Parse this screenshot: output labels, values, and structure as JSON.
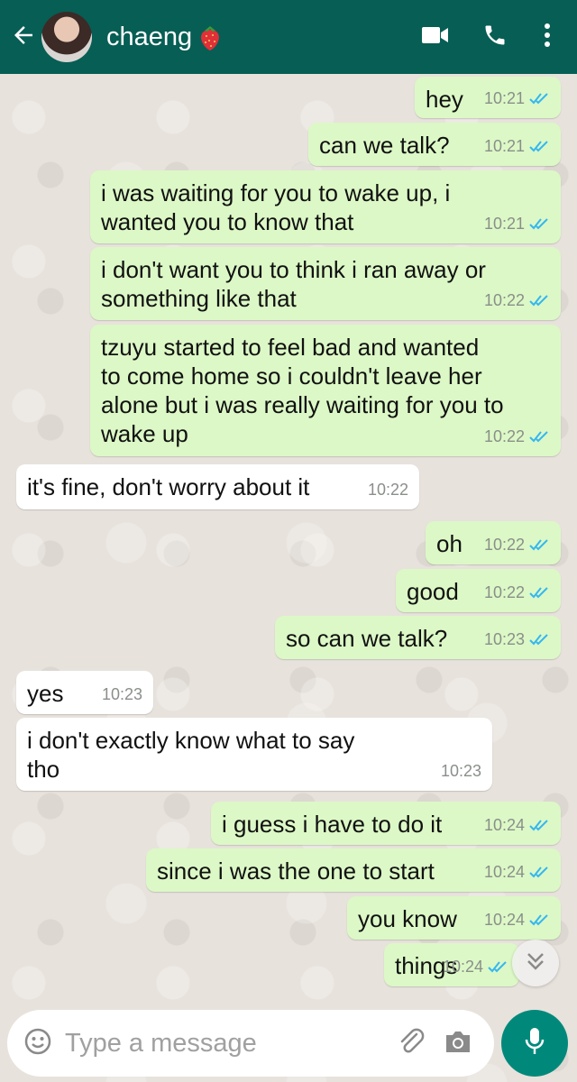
{
  "header": {
    "back_icon": "arrow-left-icon",
    "contact_name": "chaeng",
    "contact_emoji": "strawberry",
    "actions": [
      "video-call-icon",
      "voice-call-icon",
      "more-vert-icon"
    ]
  },
  "messages": [
    {
      "dir": "out",
      "text": "hey",
      "time": "10:21",
      "read": true
    },
    {
      "dir": "out",
      "text": "can we talk?",
      "time": "10:21",
      "read": true
    },
    {
      "dir": "out",
      "text": "i was waiting for you to wake up, i\nwanted you to know that",
      "time": "10:21",
      "read": true
    },
    {
      "dir": "out",
      "text": "i don't want you to think i ran away or\nsomething like that",
      "time": "10:22",
      "read": true
    },
    {
      "dir": "out",
      "text": "tzuyu started to feel bad and wanted\nto come home so i couldn't leave her\nalone but i was really waiting for you to\nwake up",
      "time": "10:22",
      "read": true
    },
    {
      "dir": "in",
      "text": "it's fine, don't worry about it",
      "time": "10:22"
    },
    {
      "dir": "out",
      "text": "oh",
      "time": "10:22",
      "read": true
    },
    {
      "dir": "out",
      "text": "good",
      "time": "10:22",
      "read": true
    },
    {
      "dir": "out",
      "text": "so can we talk?",
      "time": "10:23",
      "read": true
    },
    {
      "dir": "in",
      "text": "yes",
      "time": "10:23"
    },
    {
      "dir": "in",
      "text": "i don't exactly know what to say\ntho",
      "time": "10:23"
    },
    {
      "dir": "out",
      "text": "i guess i have to do it",
      "time": "10:24",
      "read": true
    },
    {
      "dir": "out",
      "text": "since i was the one to start",
      "time": "10:24",
      "read": true
    },
    {
      "dir": "out",
      "text": "you know",
      "time": "10:24",
      "read": true
    },
    {
      "dir": "out",
      "text": "things",
      "time": "10:24",
      "read": true
    }
  ],
  "composer": {
    "placeholder": "Type a message",
    "emoji_icon": "smiley-icon",
    "attach_icon": "paperclip-icon",
    "camera_icon": "camera-icon",
    "mic_icon": "microphone-icon"
  },
  "colors": {
    "header": "#075e54",
    "outgoing_bubble": "#dcf8c6",
    "incoming_bubble": "#ffffff",
    "read_ticks": "#34b7f1",
    "mic_button": "#00897b"
  }
}
